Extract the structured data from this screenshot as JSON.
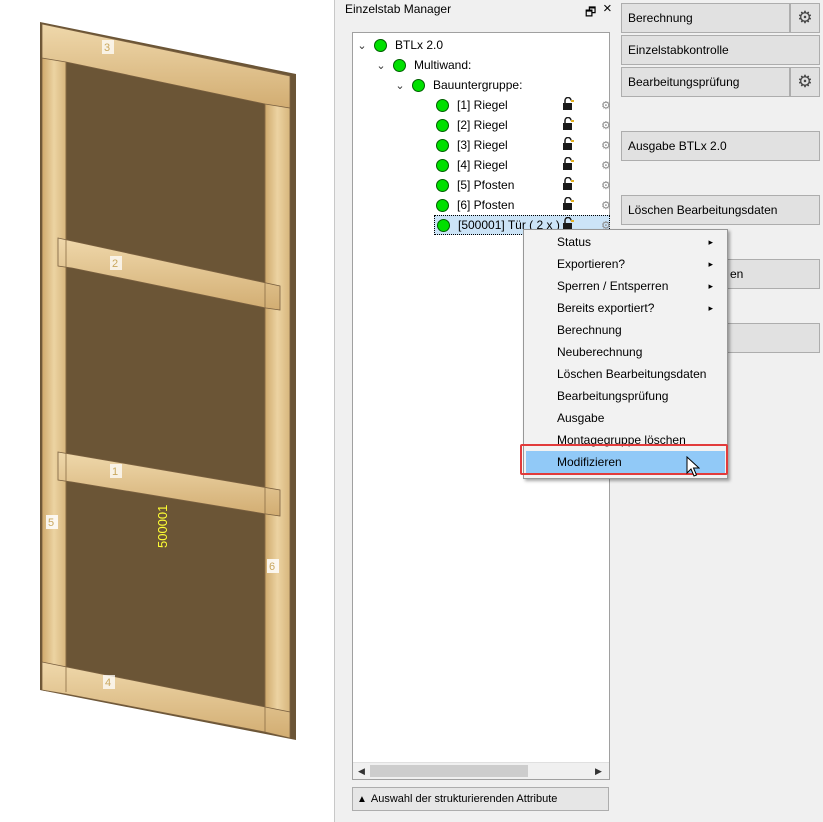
{
  "viewport": {
    "labels": [
      "3",
      "2",
      "1",
      "4",
      "5",
      "6"
    ],
    "main_label": "500001"
  },
  "manager": {
    "title": "Einzelstab Manager",
    "pin_symbol": "🗗",
    "close_symbol": "×",
    "tree": [
      {
        "label": "BTLx 2.0",
        "level": 0,
        "expanded": true
      },
      {
        "label": "Multiwand:",
        "level": 1,
        "expanded": true
      },
      {
        "label": "Bauuntergruppe:",
        "level": 2,
        "expanded": true
      },
      {
        "label": "[1] Riegel",
        "level": 3
      },
      {
        "label": "[2] Riegel",
        "level": 3
      },
      {
        "label": "[3] Riegel",
        "level": 3
      },
      {
        "label": "[4] Riegel",
        "level": 3
      },
      {
        "label": "[5] Pfosten",
        "level": 3
      },
      {
        "label": "[6] Pfosten",
        "level": 3
      },
      {
        "label": "[500001] Tür ( 2 x )",
        "level": 3,
        "selected": true
      }
    ],
    "attr_button": "Auswahl der strukturierenden Attribute"
  },
  "right": {
    "buttons": {
      "berechnung": "Berechnung",
      "einzelstabkontrolle": "Einzelstabkontrolle",
      "bearbeitungspruefung": "Bearbeitungsprüfung",
      "ausgabe": "Ausgabe BTLx 2.0",
      "loeschen": "Löschen Bearbeitungsdaten",
      "hidden_suffix": "en"
    }
  },
  "context_menu": {
    "items": [
      {
        "label": "Status",
        "submenu": true
      },
      {
        "label": "Exportieren?",
        "submenu": true
      },
      {
        "label": "Sperren / Entsperren",
        "submenu": true
      },
      {
        "label": "Bereits exportiert?",
        "submenu": true
      },
      {
        "label": "Berechnung"
      },
      {
        "label": "Neuberechnung"
      },
      {
        "label": "Löschen Bearbeitungsdaten"
      },
      {
        "label": "Bearbeitungsprüfung"
      },
      {
        "label": "Ausgabe"
      },
      {
        "label": "Montagegruppe löschen"
      },
      {
        "label": "Modifizieren",
        "highlighted": true
      }
    ],
    "arrow": "▸"
  },
  "colors": {
    "status_green": "#00e000",
    "highlight": "#91c9f7",
    "frame_red": "#e23b3b",
    "wood": "#e2c48f"
  }
}
